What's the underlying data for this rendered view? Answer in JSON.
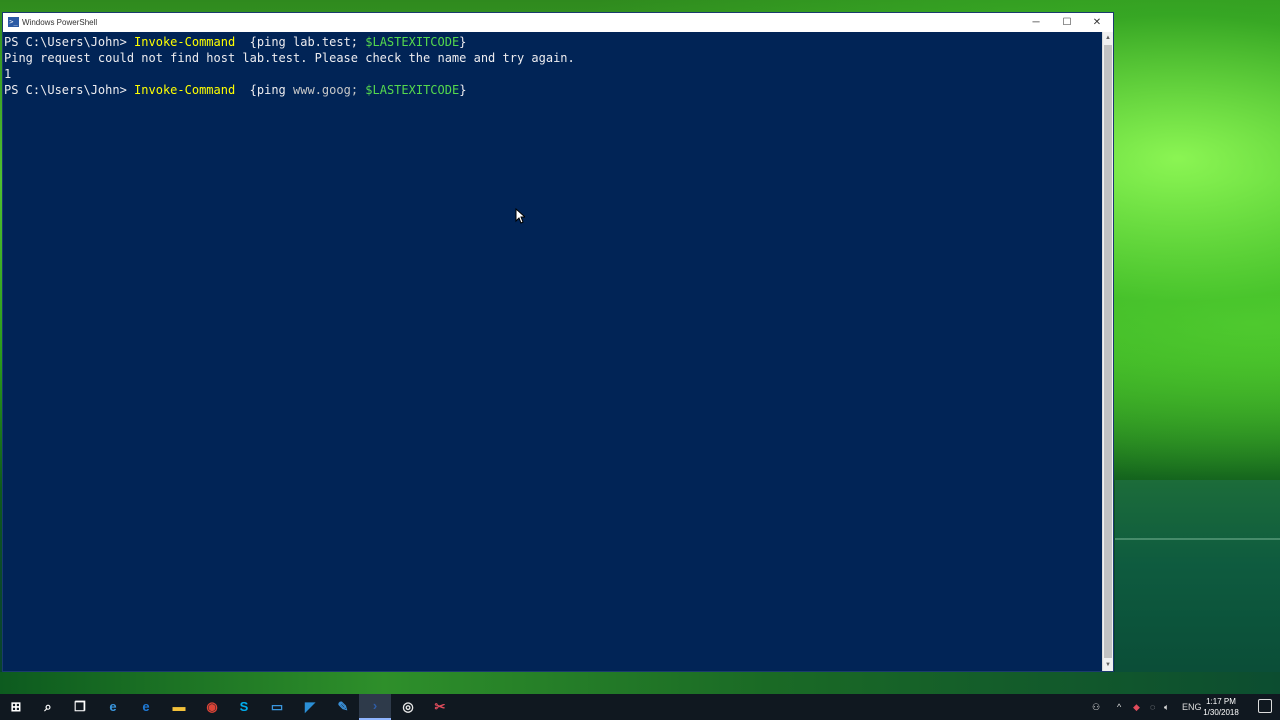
{
  "window": {
    "title": "Windows PowerShell",
    "icon_label": ">_",
    "minimize_glyph": "─",
    "maximize_glyph": "☐",
    "close_glyph": "✕"
  },
  "console": {
    "line1": {
      "prompt": "PS C:\\Users\\John> ",
      "cmdlet": "Invoke-Command",
      "space": "  ",
      "open": "{ping lab.test; ",
      "var": "$LASTEXITCODE",
      "close": "}"
    },
    "line2": "Ping request could not find host lab.test. Please check the name and try again.",
    "line3": "1",
    "line4": {
      "prompt": "PS C:\\Users\\John> ",
      "cmdlet": "Invoke-Command",
      "space": "  ",
      "open": "{ping ",
      "arg": "www.goog; ",
      "var": "$LASTEXITCODE",
      "close": "}"
    }
  },
  "taskbar": {
    "items": [
      {
        "name": "start-button",
        "glyph": "⊞",
        "color": "#ffffff"
      },
      {
        "name": "search-icon",
        "glyph": "⌕",
        "color": "#ffffff"
      },
      {
        "name": "task-view-icon",
        "glyph": "❐",
        "color": "#ffffff"
      },
      {
        "name": "internet-explorer-icon",
        "glyph": "e",
        "color": "#3a96dd"
      },
      {
        "name": "edge-icon",
        "glyph": "e",
        "color": "#1f7ad6"
      },
      {
        "name": "file-explorer-icon",
        "glyph": "▬",
        "color": "#f3c13a"
      },
      {
        "name": "chrome-icon",
        "glyph": "◉",
        "color": "#db4437"
      },
      {
        "name": "skype-icon",
        "glyph": "S",
        "color": "#00aff0"
      },
      {
        "name": "remote-desktop-icon",
        "glyph": "▭",
        "color": "#3a96dd"
      },
      {
        "name": "visual-studio-code-icon",
        "glyph": "◤",
        "color": "#2b8fd6"
      },
      {
        "name": "powershell-ise-icon",
        "glyph": "✎",
        "color": "#3a8fd6"
      },
      {
        "name": "powershell-icon",
        "glyph": "›",
        "color": "#2f5ea8"
      },
      {
        "name": "chrome-canary-icon",
        "glyph": "◎",
        "color": "#e8e8e8"
      },
      {
        "name": "snip-tool-icon",
        "glyph": "✂",
        "color": "#e04c5c"
      }
    ],
    "tray": {
      "language": "ENG",
      "time": "1:17 PM",
      "date": "1/30/2018"
    }
  }
}
